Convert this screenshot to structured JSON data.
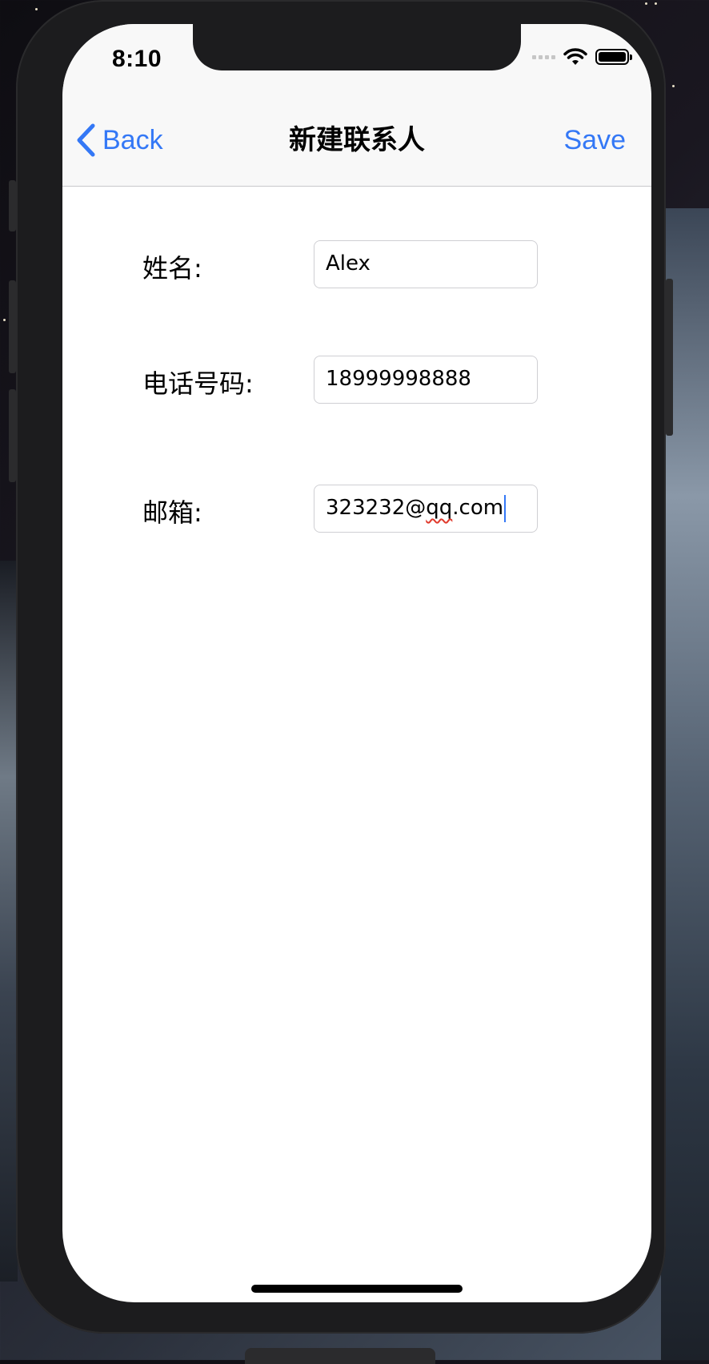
{
  "status_bar": {
    "time": "8:10"
  },
  "nav_bar": {
    "back_label": "Back",
    "title": "新建联系人",
    "save_label": "Save"
  },
  "form": {
    "name": {
      "label": "姓名:",
      "value": "Alex"
    },
    "phone": {
      "label": "电话号码:",
      "value": "18999998888"
    },
    "email": {
      "label": "邮箱:",
      "value_prefix": "323232@",
      "value_misspelled": "qq",
      "value_suffix": ".com"
    }
  },
  "colors": {
    "accent": "#3478f6",
    "spellcheck": "#e0392b"
  }
}
